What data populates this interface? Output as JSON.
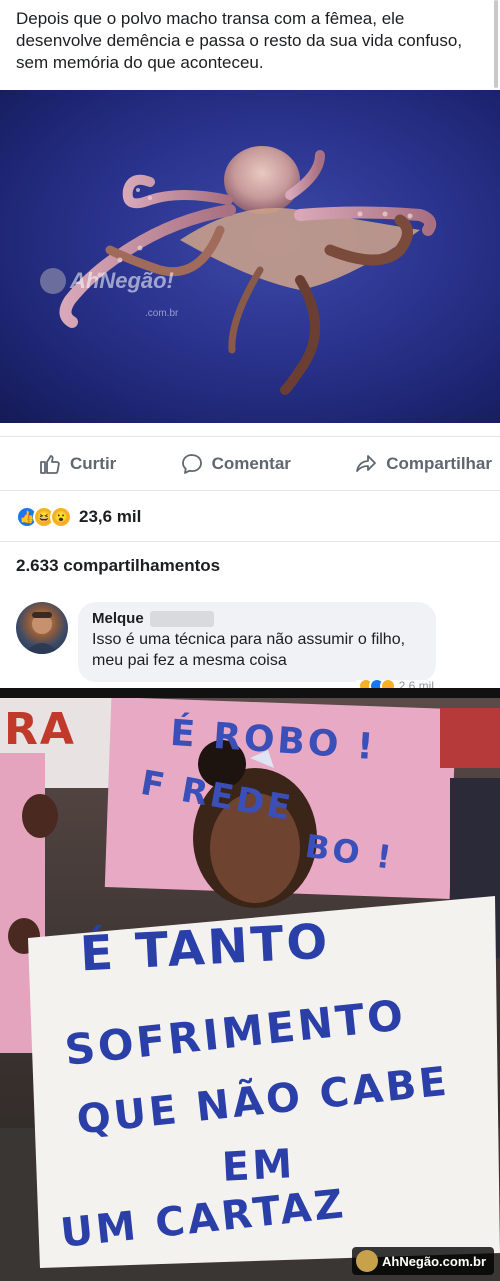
{
  "post": {
    "text": "Depois que o polvo macho transa com a fêmea, ele desenvolve demência e passa o resto da sua vida confuso, sem memória do que aconteceu."
  },
  "octopus_image": {
    "watermark_brand": "AhNegão!",
    "watermark_sub": ".com.br"
  },
  "actions": {
    "like_label": "Curtir",
    "comment_label": "Comentar",
    "share_label": "Compartilhar",
    "like_icon": "thumbs-up-icon",
    "comment_icon": "speech-bubble-icon",
    "share_icon": "share-arrow-icon"
  },
  "reactions": {
    "icons": [
      "like-icon",
      "haha-icon",
      "wow-icon"
    ],
    "count": "23,6 mil"
  },
  "shares": {
    "label": "2.633 compartilhamentos"
  },
  "comment": {
    "author": "Melque",
    "text": "Isso é uma técnica para não assumir o filho, meu pai fez a mesma coisa",
    "reaction_count": "2,6 mil"
  },
  "protest_image": {
    "sign_back_lines": [
      "É ROBO !",
      "F  REDE",
      "BO !",
      "RA"
    ],
    "sign_main_lines": [
      "É TANTO",
      "SOFRIMENTO",
      "QUE NÃO CABE",
      "EM",
      "UM CARTAZ"
    ],
    "watermark": "AhNegão.com.br"
  },
  "colors": {
    "like_blue": "#1877f2",
    "reaction_yellow": "#f7b125",
    "sign_ink": "#2b3fa8",
    "octopus_bg": "#2c3590"
  }
}
